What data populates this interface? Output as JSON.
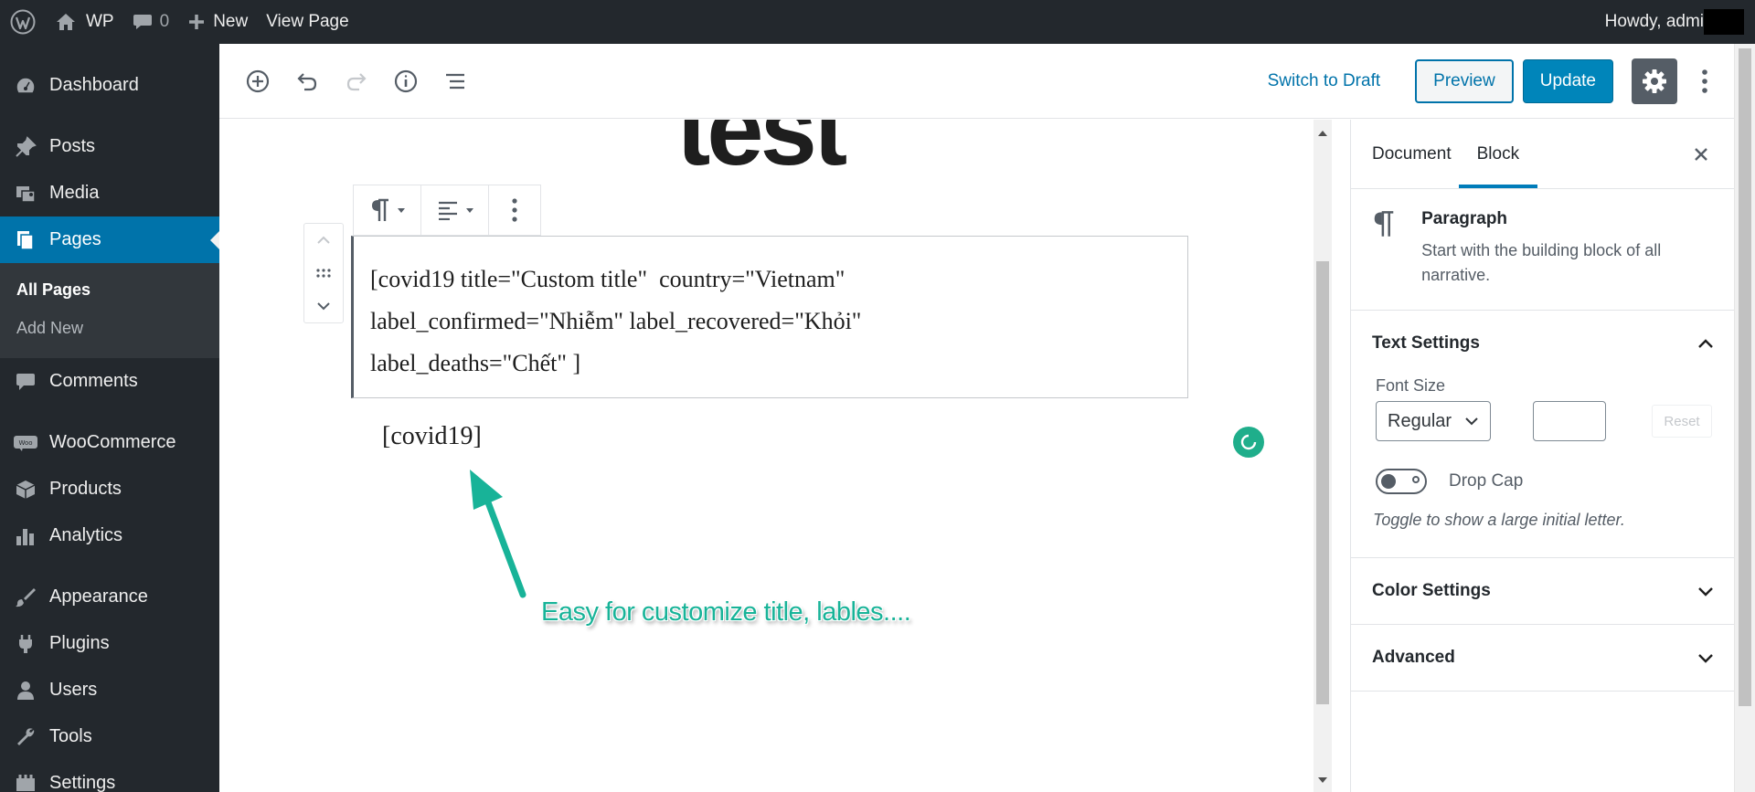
{
  "adminbar": {
    "site_name": "WP",
    "comments_count": "0",
    "new_label": "New",
    "view_page_label": "View Page",
    "howdy": "Howdy, admi"
  },
  "sidebar": {
    "items": [
      {
        "label": "Dashboard",
        "icon": "dashboard-icon"
      },
      {
        "label": "Posts",
        "icon": "pin-icon"
      },
      {
        "label": "Media",
        "icon": "media-icon"
      },
      {
        "label": "Pages",
        "icon": "pages-icon",
        "current": true
      },
      {
        "label": "Comments",
        "icon": "comment-icon"
      },
      {
        "label": "WooCommerce",
        "icon": "woocommerce-icon"
      },
      {
        "label": "Products",
        "icon": "box-icon"
      },
      {
        "label": "Analytics",
        "icon": "bar-chart-icon"
      },
      {
        "label": "Appearance",
        "icon": "paintbrush-icon"
      },
      {
        "label": "Plugins",
        "icon": "plug-icon"
      },
      {
        "label": "Users",
        "icon": "user-icon"
      },
      {
        "label": "Tools",
        "icon": "wrench-icon"
      },
      {
        "label": "Settings",
        "icon": "settings-icon"
      }
    ],
    "submenu": [
      {
        "label": "All Pages",
        "active": true
      },
      {
        "label": "Add New"
      }
    ]
  },
  "header": {
    "switch_to_draft": "Switch to Draft",
    "preview": "Preview",
    "update": "Update"
  },
  "canvas": {
    "title_fragment": "test",
    "shortcode_lines": [
      "[covid19 title=\"Custom title\"  country=\"Vietnam\"",
      "label_confirmed=\"Nhiễm\" label_recovered=\"Khỏi\"",
      "label_deaths=\"Chết\" ]"
    ],
    "plain_shortcode": "[covid19]",
    "annotation": "Easy for customize title, lables...."
  },
  "settings": {
    "tabs": [
      "Document",
      "Block"
    ],
    "active_tab": "Block",
    "block_name": "Paragraph",
    "block_description": "Start with the building block of all narrative.",
    "text_settings_title": "Text Settings",
    "font_size_label": "Font Size",
    "font_size_value": "Regular",
    "reset_label": "Reset",
    "drop_cap_label": "Drop Cap",
    "drop_cap_help": "Toggle to show a large initial letter.",
    "color_settings_title": "Color Settings",
    "advanced_title": "Advanced"
  },
  "colors": {
    "admin_dark": "#23282d",
    "accent_blue": "#0073aa",
    "annotation_green": "#18b398"
  }
}
